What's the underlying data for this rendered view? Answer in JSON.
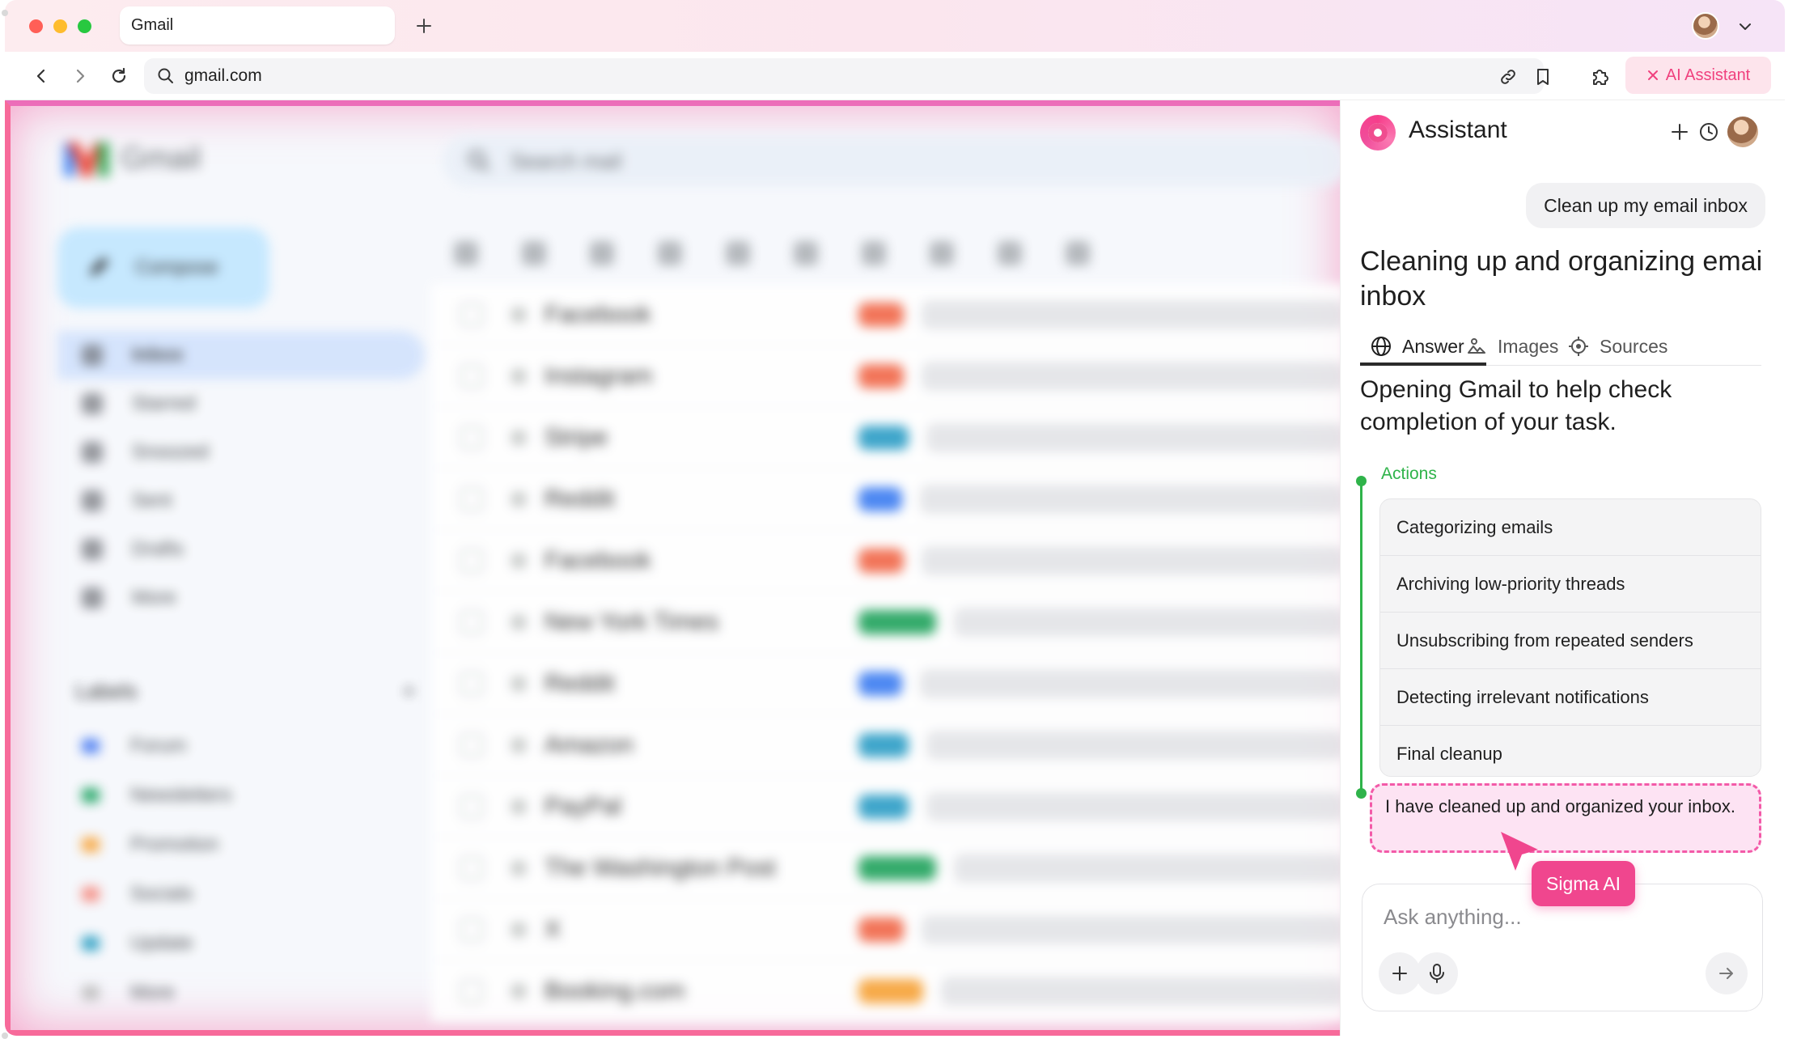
{
  "browser": {
    "tab_title": "Gmail",
    "url": "gmail.com",
    "ai_button_label": "AI Assistant"
  },
  "gmail": {
    "app_name": "Gmail",
    "search_placeholder": "Search mail",
    "compose_label": "Compose",
    "nav": [
      {
        "label": "Inbox",
        "active": true
      },
      {
        "label": "Starred"
      },
      {
        "label": "Snoozed"
      },
      {
        "label": "Sent"
      },
      {
        "label": "Drafts"
      },
      {
        "label": "More"
      }
    ],
    "labels_heading": "Labels",
    "labels": [
      {
        "label": "Forum",
        "color": "#4a7cf2"
      },
      {
        "label": "Newsletters",
        "color": "#1fa463"
      },
      {
        "label": "Promotion",
        "color": "#f8a43a"
      },
      {
        "label": "Socials",
        "color": "#f58a80"
      },
      {
        "label": "Update",
        "color": "#2a9ec2"
      },
      {
        "label": "More",
        "color": "#bdbdbd"
      }
    ],
    "emails": [
      {
        "sender": "Facebook",
        "tag_color": "#f26a4b",
        "tag_width": 56
      },
      {
        "sender": "Instagram",
        "tag_color": "#f26a4b",
        "tag_width": 56
      },
      {
        "sender": "Stripe",
        "tag_color": "#2f9fc7",
        "tag_width": 62
      },
      {
        "sender": "Reddit",
        "tag_color": "#3f7ff2",
        "tag_width": 54
      },
      {
        "sender": "Facebook",
        "tag_color": "#f26a4b",
        "tag_width": 56
      },
      {
        "sender": "New York Times",
        "tag_color": "#23a45e",
        "tag_width": 96
      },
      {
        "sender": "Reddit",
        "tag_color": "#3f7ff2",
        "tag_width": 54
      },
      {
        "sender": "Amazon",
        "tag_color": "#2f9fc7",
        "tag_width": 62
      },
      {
        "sender": "PayPal",
        "tag_color": "#2f9fc7",
        "tag_width": 62
      },
      {
        "sender": "The Washington Post",
        "tag_color": "#23a45e",
        "tag_width": 96
      },
      {
        "sender": "X",
        "tag_color": "#f26a4b",
        "tag_width": 56
      },
      {
        "sender": "Booking.com",
        "tag_color": "#f8a43a",
        "tag_width": 80
      }
    ]
  },
  "assistant": {
    "title": "Assistant",
    "user_message": "Clean up my email inbox",
    "heading": "Cleaning up and organizing emai inbox",
    "tabs": [
      {
        "label": "Answer",
        "icon": "globe-icon",
        "active": true
      },
      {
        "label": "Images",
        "icon": "images-icon"
      },
      {
        "label": "Sources",
        "icon": "sources-icon"
      }
    ],
    "answer_text": "Opening Gmail to help check completion of your task.",
    "actions_label": "Actions",
    "actions": [
      "Categorizing emails",
      "Archiving low-priority threads",
      "Unsubscribing from repeated senders",
      "Detecting irrelevant notifications",
      "Final cleanup"
    ],
    "result_text": "I have cleaned up and organized your inbox.",
    "cursor_label": "Sigma AI",
    "input_placeholder": "Ask anything...",
    "accent_color": "#f0468e",
    "status_color": "#2fb34a"
  }
}
